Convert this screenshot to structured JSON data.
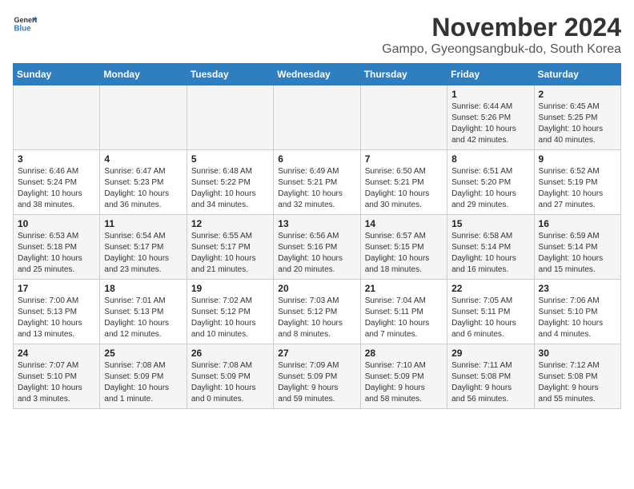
{
  "logo": {
    "line1": "General",
    "line2": "Blue"
  },
  "title": "November 2024",
  "location": "Gampo, Gyeongsangbuk-do, South Korea",
  "weekdays": [
    "Sunday",
    "Monday",
    "Tuesday",
    "Wednesday",
    "Thursday",
    "Friday",
    "Saturday"
  ],
  "weeks": [
    [
      {
        "day": "",
        "info": ""
      },
      {
        "day": "",
        "info": ""
      },
      {
        "day": "",
        "info": ""
      },
      {
        "day": "",
        "info": ""
      },
      {
        "day": "",
        "info": ""
      },
      {
        "day": "1",
        "info": "Sunrise: 6:44 AM\nSunset: 5:26 PM\nDaylight: 10 hours\nand 42 minutes."
      },
      {
        "day": "2",
        "info": "Sunrise: 6:45 AM\nSunset: 5:25 PM\nDaylight: 10 hours\nand 40 minutes."
      }
    ],
    [
      {
        "day": "3",
        "info": "Sunrise: 6:46 AM\nSunset: 5:24 PM\nDaylight: 10 hours\nand 38 minutes."
      },
      {
        "day": "4",
        "info": "Sunrise: 6:47 AM\nSunset: 5:23 PM\nDaylight: 10 hours\nand 36 minutes."
      },
      {
        "day": "5",
        "info": "Sunrise: 6:48 AM\nSunset: 5:22 PM\nDaylight: 10 hours\nand 34 minutes."
      },
      {
        "day": "6",
        "info": "Sunrise: 6:49 AM\nSunset: 5:21 PM\nDaylight: 10 hours\nand 32 minutes."
      },
      {
        "day": "7",
        "info": "Sunrise: 6:50 AM\nSunset: 5:21 PM\nDaylight: 10 hours\nand 30 minutes."
      },
      {
        "day": "8",
        "info": "Sunrise: 6:51 AM\nSunset: 5:20 PM\nDaylight: 10 hours\nand 29 minutes."
      },
      {
        "day": "9",
        "info": "Sunrise: 6:52 AM\nSunset: 5:19 PM\nDaylight: 10 hours\nand 27 minutes."
      }
    ],
    [
      {
        "day": "10",
        "info": "Sunrise: 6:53 AM\nSunset: 5:18 PM\nDaylight: 10 hours\nand 25 minutes."
      },
      {
        "day": "11",
        "info": "Sunrise: 6:54 AM\nSunset: 5:17 PM\nDaylight: 10 hours\nand 23 minutes."
      },
      {
        "day": "12",
        "info": "Sunrise: 6:55 AM\nSunset: 5:17 PM\nDaylight: 10 hours\nand 21 minutes."
      },
      {
        "day": "13",
        "info": "Sunrise: 6:56 AM\nSunset: 5:16 PM\nDaylight: 10 hours\nand 20 minutes."
      },
      {
        "day": "14",
        "info": "Sunrise: 6:57 AM\nSunset: 5:15 PM\nDaylight: 10 hours\nand 18 minutes."
      },
      {
        "day": "15",
        "info": "Sunrise: 6:58 AM\nSunset: 5:14 PM\nDaylight: 10 hours\nand 16 minutes."
      },
      {
        "day": "16",
        "info": "Sunrise: 6:59 AM\nSunset: 5:14 PM\nDaylight: 10 hours\nand 15 minutes."
      }
    ],
    [
      {
        "day": "17",
        "info": "Sunrise: 7:00 AM\nSunset: 5:13 PM\nDaylight: 10 hours\nand 13 minutes."
      },
      {
        "day": "18",
        "info": "Sunrise: 7:01 AM\nSunset: 5:13 PM\nDaylight: 10 hours\nand 12 minutes."
      },
      {
        "day": "19",
        "info": "Sunrise: 7:02 AM\nSunset: 5:12 PM\nDaylight: 10 hours\nand 10 minutes."
      },
      {
        "day": "20",
        "info": "Sunrise: 7:03 AM\nSunset: 5:12 PM\nDaylight: 10 hours\nand 8 minutes."
      },
      {
        "day": "21",
        "info": "Sunrise: 7:04 AM\nSunset: 5:11 PM\nDaylight: 10 hours\nand 7 minutes."
      },
      {
        "day": "22",
        "info": "Sunrise: 7:05 AM\nSunset: 5:11 PM\nDaylight: 10 hours\nand 6 minutes."
      },
      {
        "day": "23",
        "info": "Sunrise: 7:06 AM\nSunset: 5:10 PM\nDaylight: 10 hours\nand 4 minutes."
      }
    ],
    [
      {
        "day": "24",
        "info": "Sunrise: 7:07 AM\nSunset: 5:10 PM\nDaylight: 10 hours\nand 3 minutes."
      },
      {
        "day": "25",
        "info": "Sunrise: 7:08 AM\nSunset: 5:09 PM\nDaylight: 10 hours\nand 1 minute."
      },
      {
        "day": "26",
        "info": "Sunrise: 7:08 AM\nSunset: 5:09 PM\nDaylight: 10 hours\nand 0 minutes."
      },
      {
        "day": "27",
        "info": "Sunrise: 7:09 AM\nSunset: 5:09 PM\nDaylight: 9 hours\nand 59 minutes."
      },
      {
        "day": "28",
        "info": "Sunrise: 7:10 AM\nSunset: 5:09 PM\nDaylight: 9 hours\nand 58 minutes."
      },
      {
        "day": "29",
        "info": "Sunrise: 7:11 AM\nSunset: 5:08 PM\nDaylight: 9 hours\nand 56 minutes."
      },
      {
        "day": "30",
        "info": "Sunrise: 7:12 AM\nSunset: 5:08 PM\nDaylight: 9 hours\nand 55 minutes."
      }
    ]
  ]
}
